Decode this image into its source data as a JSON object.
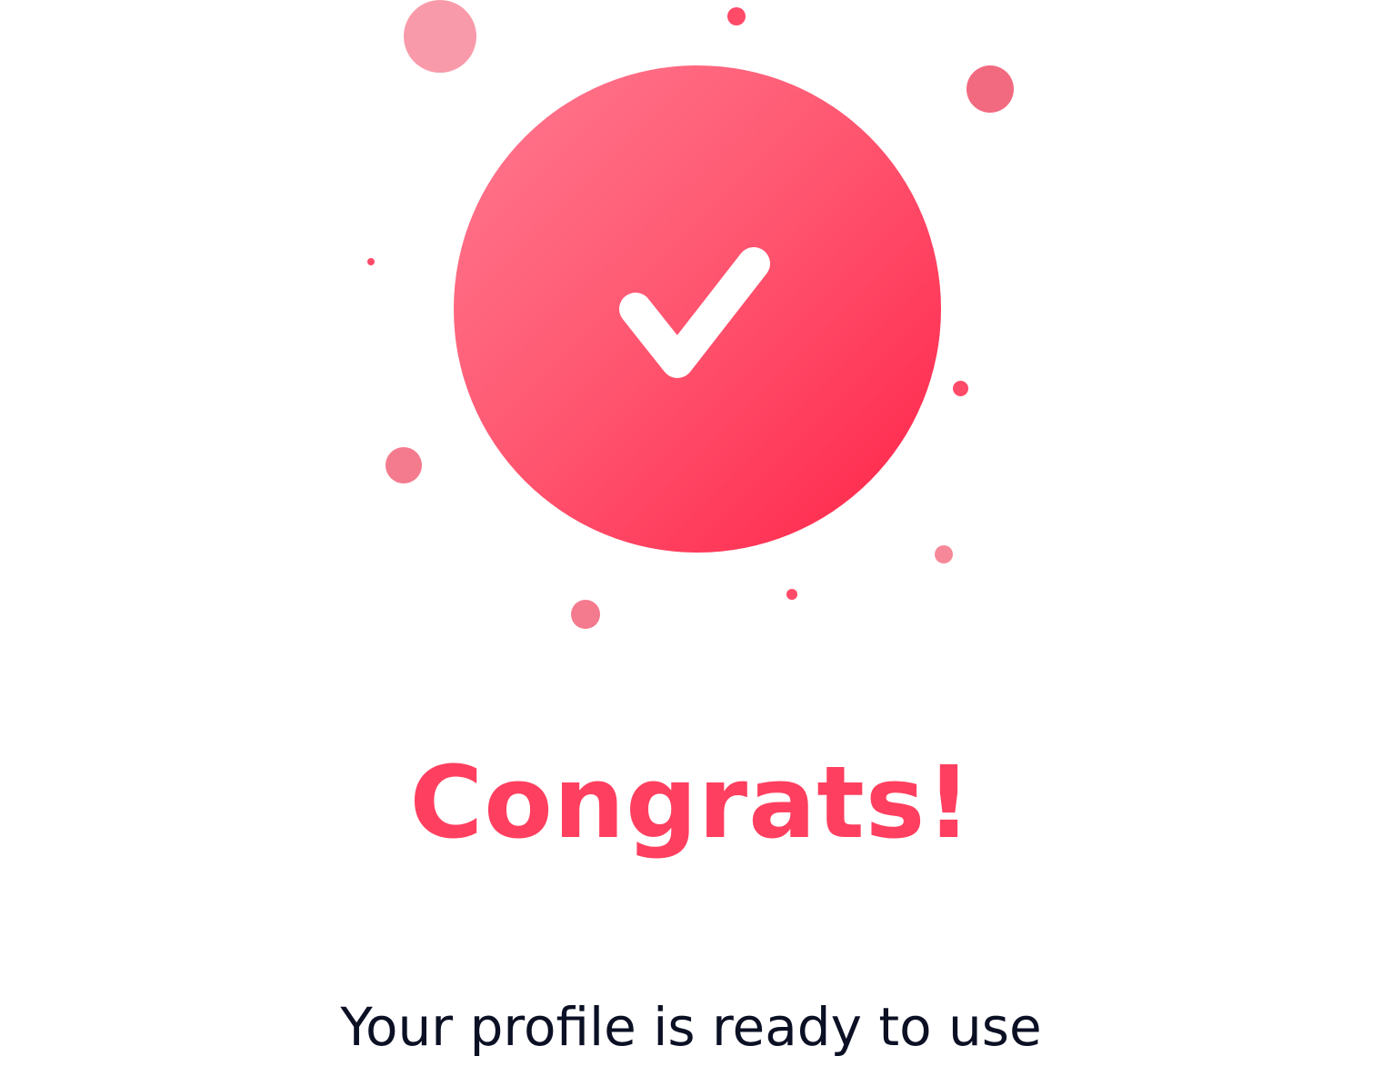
{
  "colors": {
    "accent": "#ff3f5f",
    "badge_gradient_start": "#ff7a90",
    "badge_gradient_end": "#ff2348",
    "text_dark": "#0b1024",
    "background": "#ffffff"
  },
  "icons": {
    "badge": "checkmark-icon"
  },
  "title": "Congrats!",
  "message": "Your profile is ready to use"
}
